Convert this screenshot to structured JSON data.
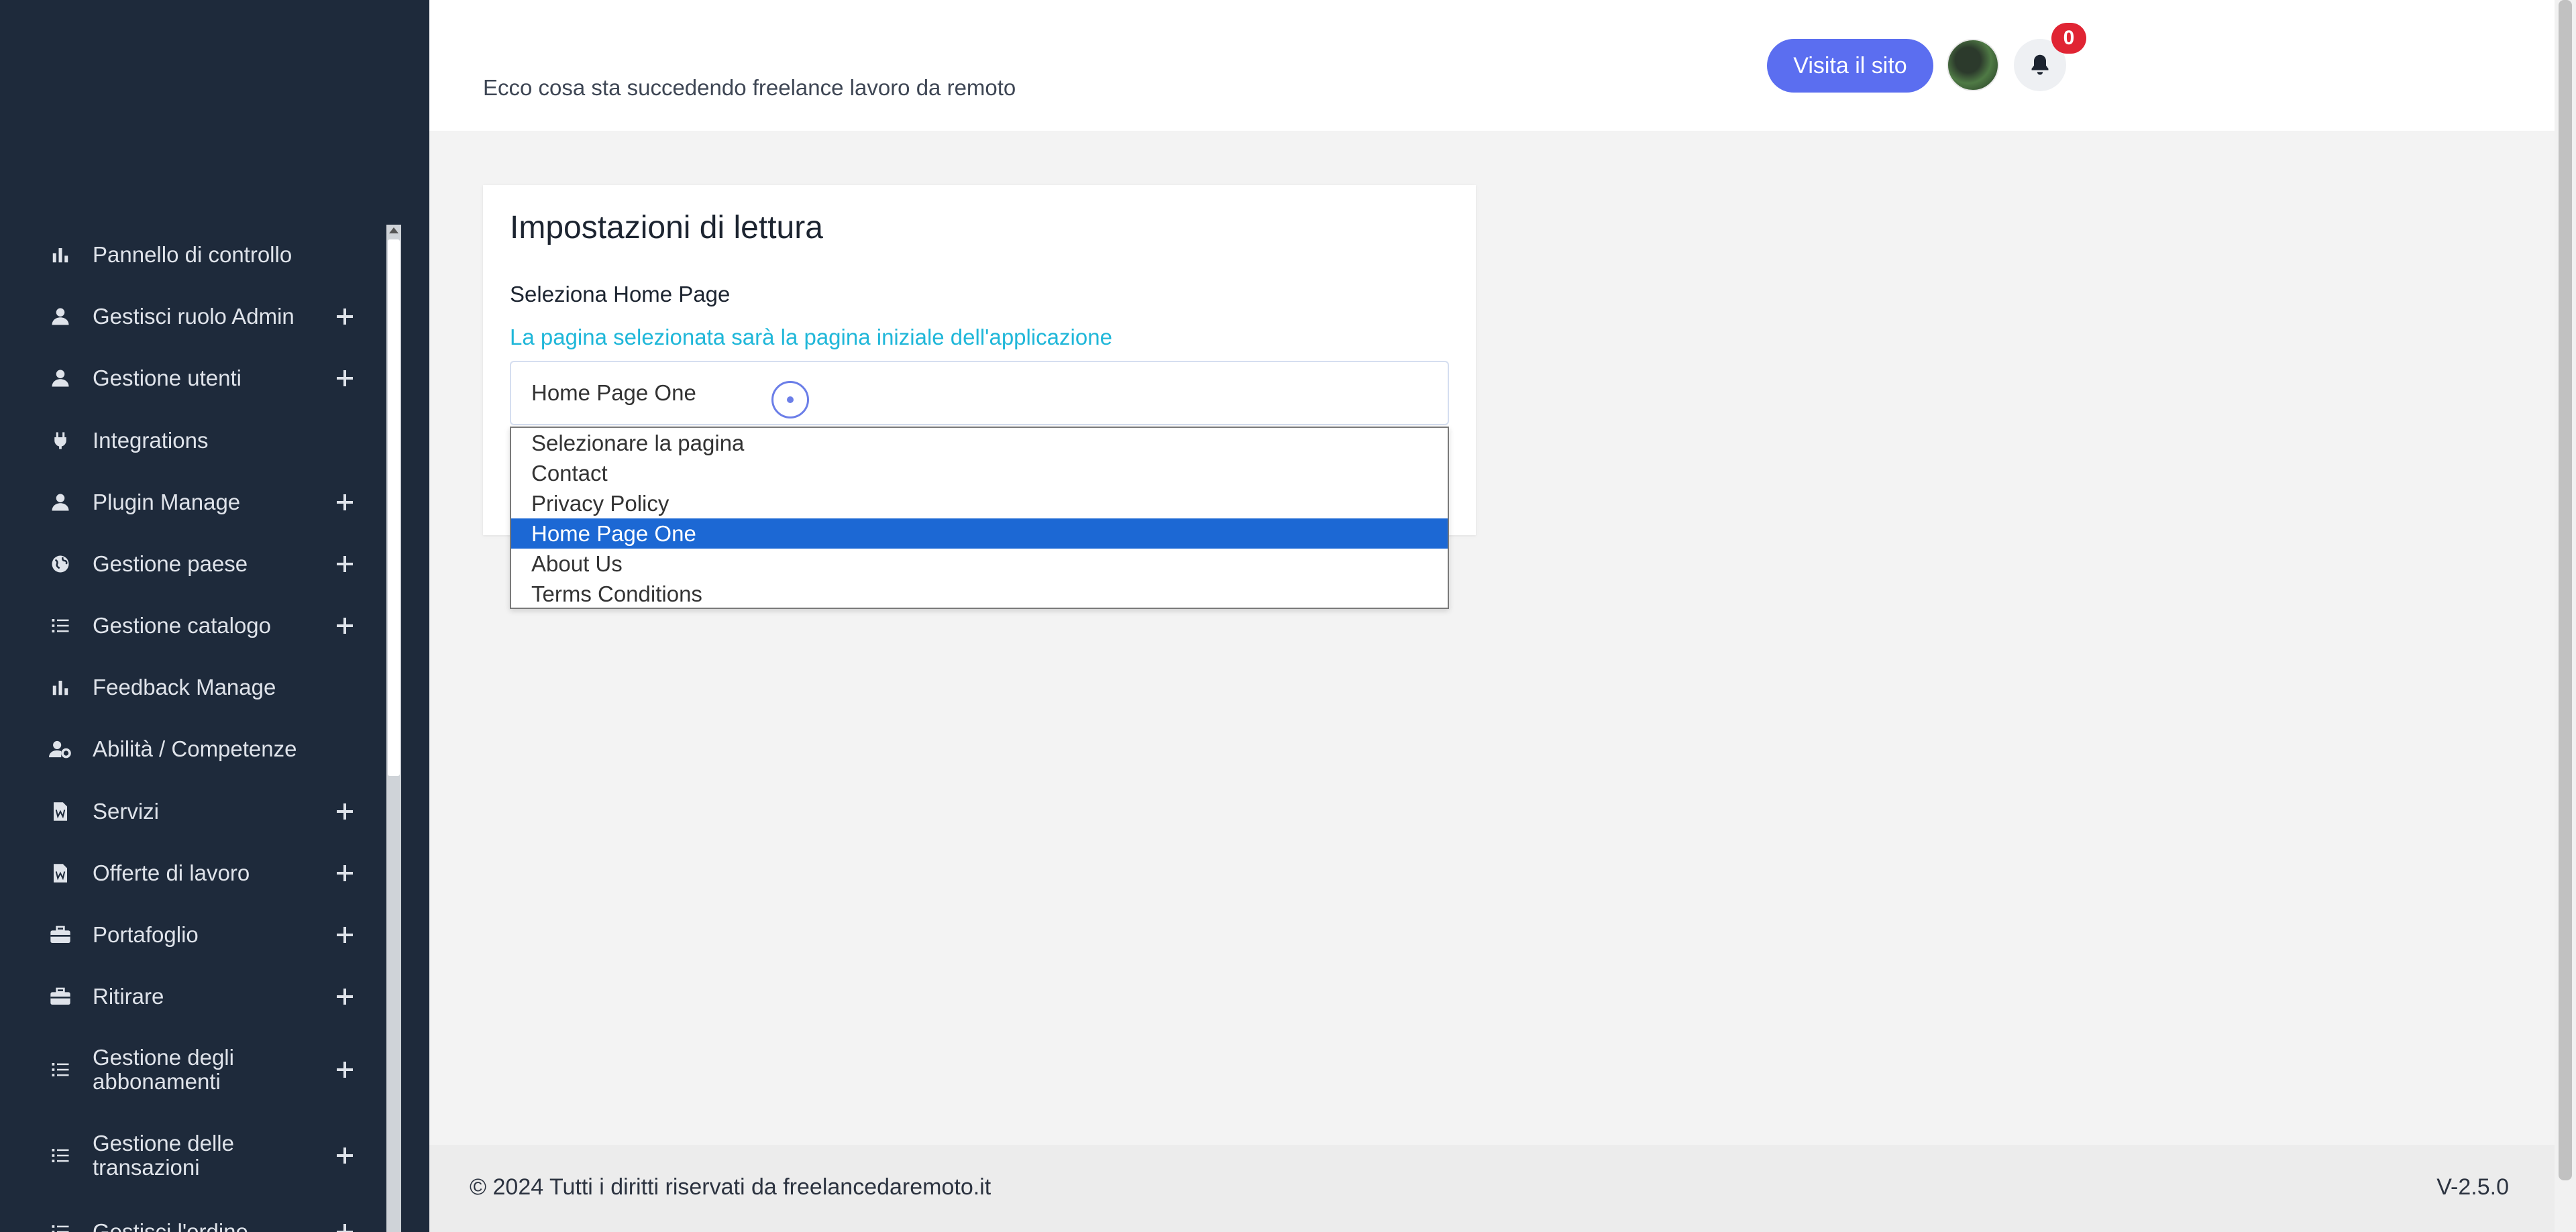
{
  "sidebar": {
    "items": [
      {
        "label": "Pannello di controllo",
        "icon": "bar-chart-icon",
        "expandable": false
      },
      {
        "label": "Gestisci ruolo Admin",
        "icon": "user-icon",
        "expandable": true
      },
      {
        "label": "Gestione utenti",
        "icon": "user-icon",
        "expandable": true
      },
      {
        "label": "Integrations",
        "icon": "plug-icon",
        "expandable": false
      },
      {
        "label": "Plugin Manage",
        "icon": "user-icon",
        "expandable": true
      },
      {
        "label": "Gestione paese",
        "icon": "globe-icon",
        "expandable": true
      },
      {
        "label": "Gestione catalogo",
        "icon": "list-icon",
        "expandable": true
      },
      {
        "label": "Feedback Manage",
        "icon": "bar-chart-icon",
        "expandable": false
      },
      {
        "label": "Abilità / Competenze",
        "icon": "user-gear-icon",
        "expandable": false
      },
      {
        "label": "Servizi",
        "icon": "document-icon",
        "expandable": true
      },
      {
        "label": "Offerte di lavoro",
        "icon": "document-icon",
        "expandable": true
      },
      {
        "label": "Portafoglio",
        "icon": "briefcase-icon",
        "expandable": true
      },
      {
        "label": "Ritirare",
        "icon": "briefcase-icon",
        "expandable": true
      },
      {
        "label": "Gestione degli abbonamenti",
        "icon": "list-icon",
        "expandable": true
      },
      {
        "label": "Gestione delle transazioni",
        "icon": "list-icon",
        "expandable": true
      },
      {
        "label": "Gestisci l'ordine",
        "icon": "list-icon",
        "expandable": true
      }
    ]
  },
  "header": {
    "tagline": "Ecco cosa sta succedendo freelance lavoro da remoto",
    "visit_button": "Visita il sito",
    "notification_count": "0"
  },
  "card": {
    "title": "Impostazioni di lettura",
    "field_label": "Seleziona Home Page",
    "field_hint": "La pagina selezionata sarà la pagina iniziale dell'applicazione",
    "selected_value": "Home Page One",
    "options": [
      {
        "label": "Selezionare la pagina",
        "selected": false
      },
      {
        "label": "Contact",
        "selected": false
      },
      {
        "label": "Privacy Policy",
        "selected": false
      },
      {
        "label": "Home Page One",
        "selected": true
      },
      {
        "label": "About Us",
        "selected": false
      },
      {
        "label": "Terms Conditions",
        "selected": false
      }
    ]
  },
  "footer": {
    "copyright": "© 2024 Tutti i diritti riservati da freelancedaremoto.it",
    "version": "V-2.5.0"
  },
  "colors": {
    "sidebar_bg": "#1e2a3b",
    "accent": "#5b6ef0",
    "hint": "#20b7d9",
    "selected_option": "#1c68d4",
    "badge": "#e02433"
  }
}
